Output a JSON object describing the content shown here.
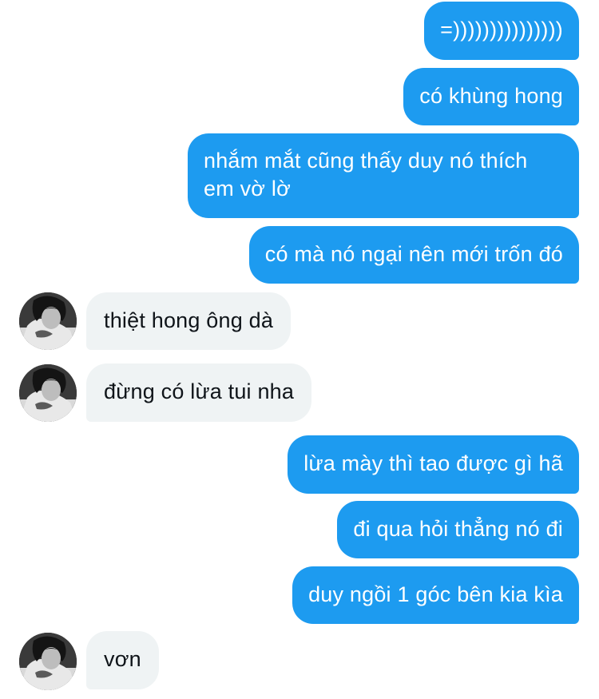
{
  "contact": {
    "avatar_icon": "contact-avatar-photo"
  },
  "colors": {
    "outgoing_bubble": "#1d9bf0",
    "incoming_bubble": "#eff3f4",
    "outgoing_text": "#ffffff",
    "incoming_text": "#0f1419"
  },
  "messages": [
    {
      "direction": "outgoing",
      "text": "=)))))))))))))))"
    },
    {
      "direction": "outgoing",
      "text": "có khùng hong"
    },
    {
      "direction": "outgoing",
      "text": "nhắm mắt cũng thấy duy nó thích em vờ lờ"
    },
    {
      "direction": "outgoing",
      "text": "có mà nó ngại nên mới trốn đó"
    },
    {
      "direction": "incoming",
      "text": "thiệt hong ông dà"
    },
    {
      "direction": "incoming",
      "text": "đừng có lừa tui nha"
    },
    {
      "direction": "outgoing",
      "text": "lừa mày thì tao được gì hã"
    },
    {
      "direction": "outgoing",
      "text": "đi qua hỏi thẳng nó đi"
    },
    {
      "direction": "outgoing",
      "text": "duy ngồi 1 góc bên kia kìa"
    },
    {
      "direction": "incoming",
      "text": "vơn"
    }
  ]
}
